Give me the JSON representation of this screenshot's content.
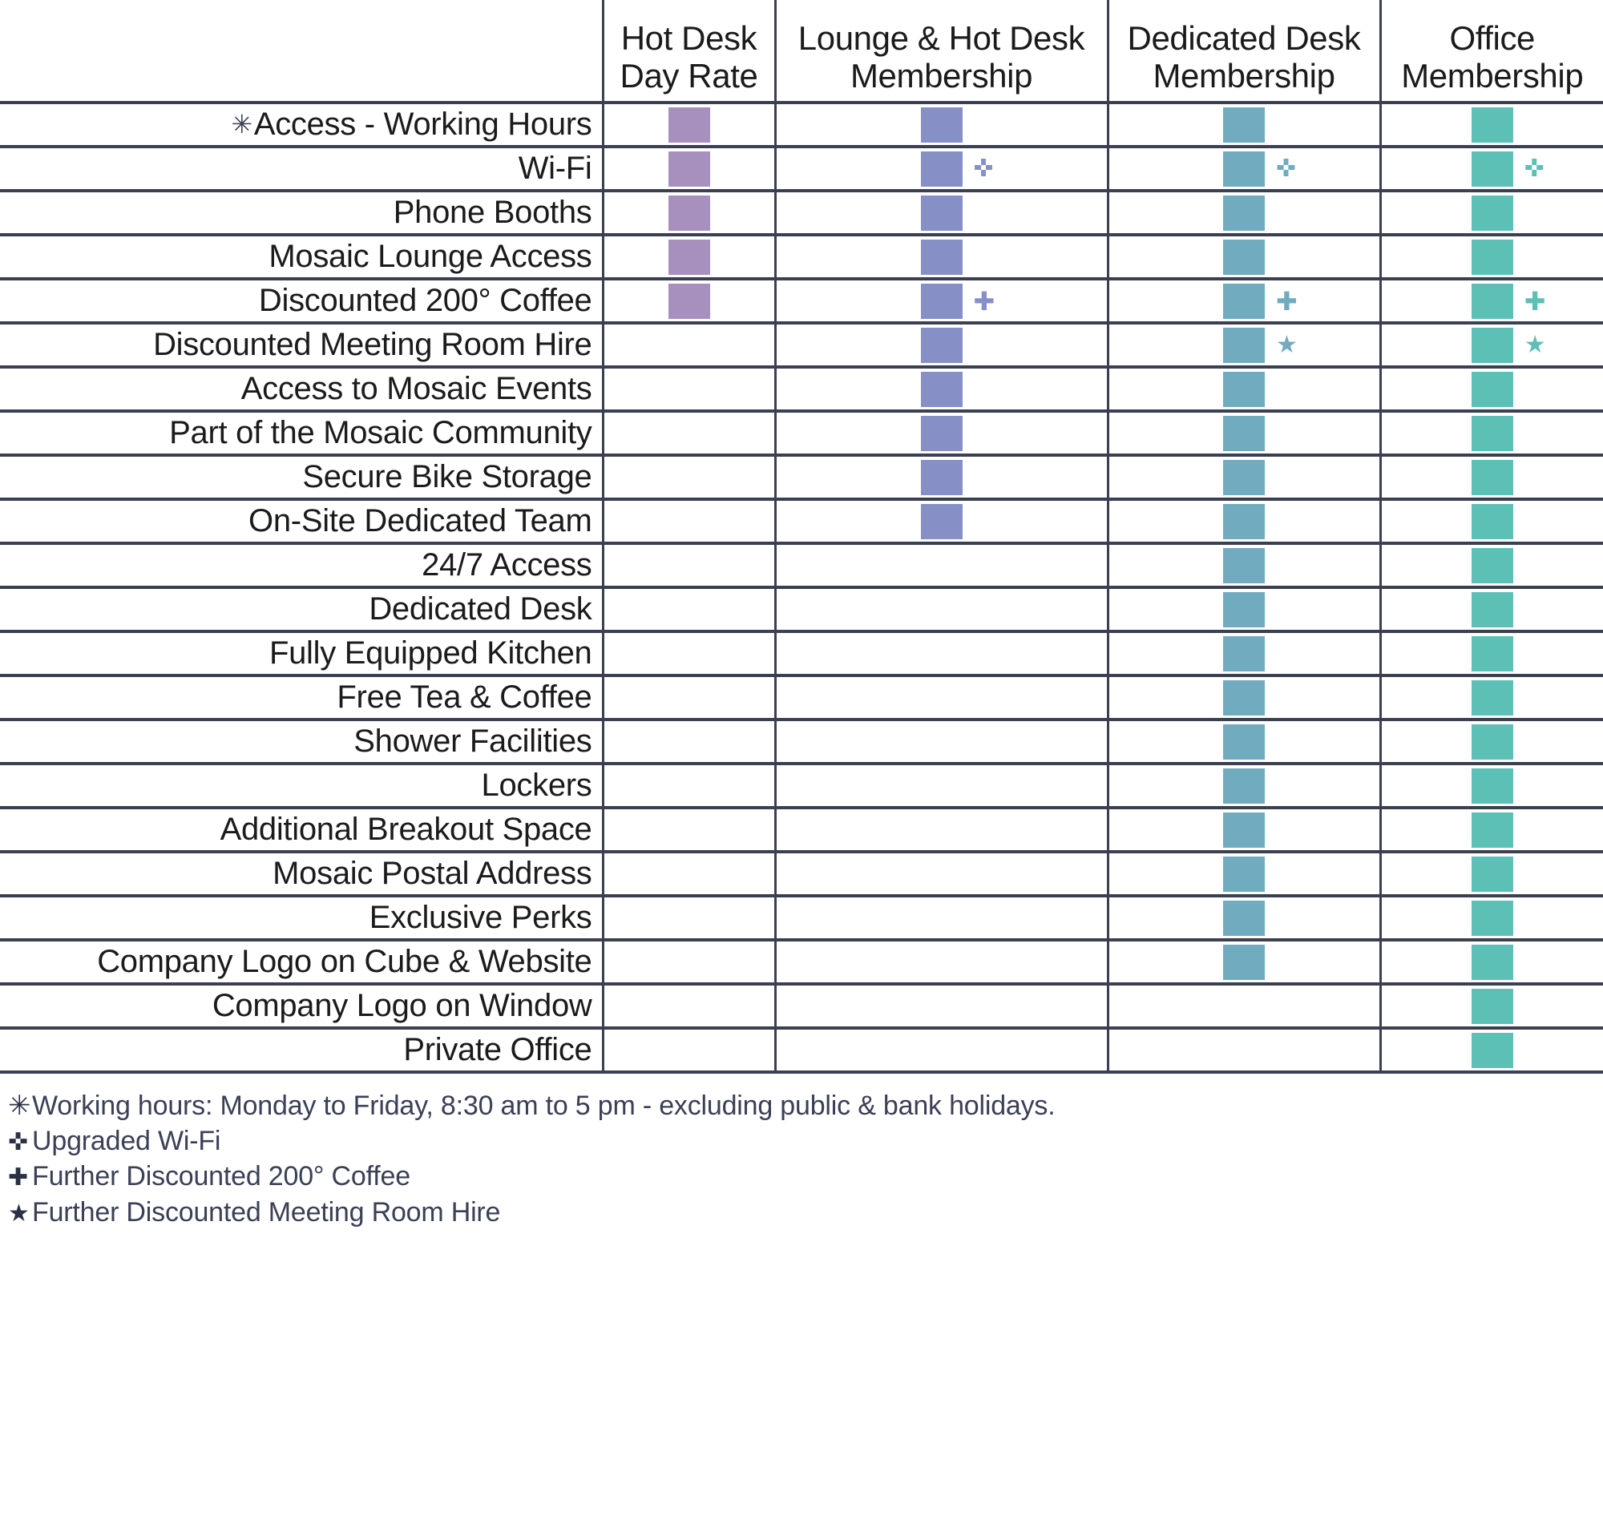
{
  "columns": [
    {
      "id": "hot-desk-day-rate",
      "line1": "Hot Desk",
      "line2": "Day Rate",
      "color": "#A890BE"
    },
    {
      "id": "lounge-hot-desk-membership",
      "line1": "Lounge & Hot Desk",
      "line2": "Membership",
      "color": "#8690C6"
    },
    {
      "id": "dedicated-desk-membership",
      "line1": "Dedicated Desk",
      "line2": "Membership",
      "color": "#70ABC0"
    },
    {
      "id": "office-membership",
      "line1": "Office",
      "line2": "Membership",
      "color": "#5DC0B7"
    }
  ],
  "icons": {
    "asterisk": "✳",
    "hollow_cross": "✜",
    "solid_plus": "✚",
    "star": "★"
  },
  "rows": [
    {
      "label": "Access - Working Hours",
      "prefix_icon": "asterisk",
      "cells": [
        {
          "on": true,
          "mark": null
        },
        {
          "on": true,
          "mark": null
        },
        {
          "on": true,
          "mark": null
        },
        {
          "on": true,
          "mark": null
        }
      ]
    },
    {
      "label": "Wi-Fi",
      "prefix_icon": null,
      "cells": [
        {
          "on": true,
          "mark": null
        },
        {
          "on": true,
          "mark": "hollow"
        },
        {
          "on": true,
          "mark": "hollow"
        },
        {
          "on": true,
          "mark": "hollow"
        }
      ]
    },
    {
      "label": "Phone Booths",
      "prefix_icon": null,
      "cells": [
        {
          "on": true,
          "mark": null
        },
        {
          "on": true,
          "mark": null
        },
        {
          "on": true,
          "mark": null
        },
        {
          "on": true,
          "mark": null
        }
      ]
    },
    {
      "label": "Mosaic Lounge Access",
      "prefix_icon": null,
      "cells": [
        {
          "on": true,
          "mark": null
        },
        {
          "on": true,
          "mark": null
        },
        {
          "on": true,
          "mark": null
        },
        {
          "on": true,
          "mark": null
        }
      ]
    },
    {
      "label": "Discounted 200° Coffee",
      "prefix_icon": null,
      "cells": [
        {
          "on": true,
          "mark": null
        },
        {
          "on": true,
          "mark": "solid"
        },
        {
          "on": true,
          "mark": "solid"
        },
        {
          "on": true,
          "mark": "solid"
        }
      ]
    },
    {
      "label": "Discounted Meeting Room Hire",
      "prefix_icon": null,
      "cells": [
        {
          "on": false,
          "mark": null
        },
        {
          "on": true,
          "mark": null
        },
        {
          "on": true,
          "mark": "star"
        },
        {
          "on": true,
          "mark": "star"
        }
      ]
    },
    {
      "label": "Access to Mosaic Events",
      "prefix_icon": null,
      "cells": [
        {
          "on": false,
          "mark": null
        },
        {
          "on": true,
          "mark": null
        },
        {
          "on": true,
          "mark": null
        },
        {
          "on": true,
          "mark": null
        }
      ]
    },
    {
      "label": "Part of the Mosaic Community",
      "prefix_icon": null,
      "cells": [
        {
          "on": false,
          "mark": null
        },
        {
          "on": true,
          "mark": null
        },
        {
          "on": true,
          "mark": null
        },
        {
          "on": true,
          "mark": null
        }
      ]
    },
    {
      "label": "Secure Bike Storage",
      "prefix_icon": null,
      "cells": [
        {
          "on": false,
          "mark": null
        },
        {
          "on": true,
          "mark": null
        },
        {
          "on": true,
          "mark": null
        },
        {
          "on": true,
          "mark": null
        }
      ]
    },
    {
      "label": "On-Site Dedicated Team",
      "prefix_icon": null,
      "cells": [
        {
          "on": false,
          "mark": null
        },
        {
          "on": true,
          "mark": null
        },
        {
          "on": true,
          "mark": null
        },
        {
          "on": true,
          "mark": null
        }
      ]
    },
    {
      "label": "24/7 Access",
      "prefix_icon": null,
      "cells": [
        {
          "on": false,
          "mark": null
        },
        {
          "on": false,
          "mark": null
        },
        {
          "on": true,
          "mark": null
        },
        {
          "on": true,
          "mark": null
        }
      ]
    },
    {
      "label": "Dedicated Desk",
      "prefix_icon": null,
      "cells": [
        {
          "on": false,
          "mark": null
        },
        {
          "on": false,
          "mark": null
        },
        {
          "on": true,
          "mark": null
        },
        {
          "on": true,
          "mark": null
        }
      ]
    },
    {
      "label": "Fully Equipped Kitchen",
      "prefix_icon": null,
      "cells": [
        {
          "on": false,
          "mark": null
        },
        {
          "on": false,
          "mark": null
        },
        {
          "on": true,
          "mark": null
        },
        {
          "on": true,
          "mark": null
        }
      ]
    },
    {
      "label": "Free Tea & Coffee",
      "prefix_icon": null,
      "cells": [
        {
          "on": false,
          "mark": null
        },
        {
          "on": false,
          "mark": null
        },
        {
          "on": true,
          "mark": null
        },
        {
          "on": true,
          "mark": null
        }
      ]
    },
    {
      "label": "Shower Facilities",
      "prefix_icon": null,
      "cells": [
        {
          "on": false,
          "mark": null
        },
        {
          "on": false,
          "mark": null
        },
        {
          "on": true,
          "mark": null
        },
        {
          "on": true,
          "mark": null
        }
      ]
    },
    {
      "label": "Lockers",
      "prefix_icon": null,
      "cells": [
        {
          "on": false,
          "mark": null
        },
        {
          "on": false,
          "mark": null
        },
        {
          "on": true,
          "mark": null
        },
        {
          "on": true,
          "mark": null
        }
      ]
    },
    {
      "label": "Additional Breakout Space",
      "prefix_icon": null,
      "cells": [
        {
          "on": false,
          "mark": null
        },
        {
          "on": false,
          "mark": null
        },
        {
          "on": true,
          "mark": null
        },
        {
          "on": true,
          "mark": null
        }
      ]
    },
    {
      "label": "Mosaic Postal Address",
      "prefix_icon": null,
      "cells": [
        {
          "on": false,
          "mark": null
        },
        {
          "on": false,
          "mark": null
        },
        {
          "on": true,
          "mark": null
        },
        {
          "on": true,
          "mark": null
        }
      ]
    },
    {
      "label": "Exclusive Perks",
      "prefix_icon": null,
      "cells": [
        {
          "on": false,
          "mark": null
        },
        {
          "on": false,
          "mark": null
        },
        {
          "on": true,
          "mark": null
        },
        {
          "on": true,
          "mark": null
        }
      ]
    },
    {
      "label": "Company Logo on Cube & Website",
      "prefix_icon": null,
      "cells": [
        {
          "on": false,
          "mark": null
        },
        {
          "on": false,
          "mark": null
        },
        {
          "on": true,
          "mark": null
        },
        {
          "on": true,
          "mark": null
        }
      ]
    },
    {
      "label": "Company Logo on Window",
      "prefix_icon": null,
      "cells": [
        {
          "on": false,
          "mark": null
        },
        {
          "on": false,
          "mark": null
        },
        {
          "on": false,
          "mark": null
        },
        {
          "on": true,
          "mark": null
        }
      ]
    },
    {
      "label": "Private Office",
      "prefix_icon": null,
      "cells": [
        {
          "on": false,
          "mark": null
        },
        {
          "on": false,
          "mark": null
        },
        {
          "on": false,
          "mark": null
        },
        {
          "on": true,
          "mark": null
        }
      ]
    }
  ],
  "footnotes": [
    {
      "glyph": "✳",
      "text": "Working hours: Monday to Friday, 8:30 am to 5 pm - excluding public & bank holidays."
    },
    {
      "glyph": "✜",
      "text": "Upgraded Wi-Fi"
    },
    {
      "glyph": "✚",
      "text": "Further Discounted 200° Coffee"
    },
    {
      "glyph": "★",
      "text": "Further Discounted Meeting Room Hire"
    }
  ]
}
